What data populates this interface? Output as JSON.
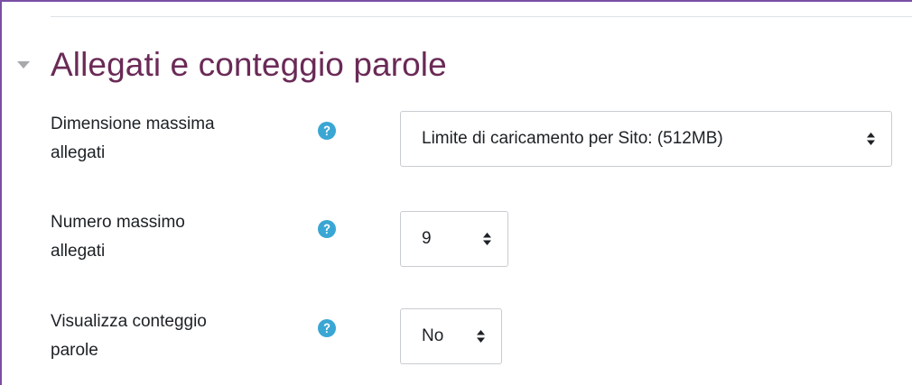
{
  "section": {
    "title": "Allegati e conteggio parole",
    "toggle_icon": "caret-down-icon"
  },
  "fields": [
    {
      "label_line1": "Dimensione massima",
      "label_line2": "allegati",
      "help_icon": "question-circle-icon",
      "value": "Limite di caricamento per Sito: (512MB)"
    },
    {
      "label_line1": "Numero massimo",
      "label_line2": "allegati",
      "help_icon": "question-circle-icon",
      "value": "9"
    },
    {
      "label_line1": "Visualizza conteggio",
      "label_line2": "parole",
      "help_icon": "question-circle-icon",
      "value": "No"
    }
  ],
  "colors": {
    "title": "#6a2a56",
    "help_icon": "#3aa6d4",
    "frame_border": "#7b4fa5"
  }
}
